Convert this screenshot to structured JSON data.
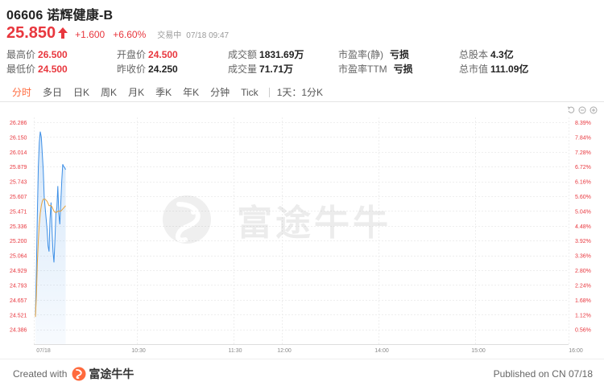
{
  "stock": {
    "title": "06606 诺辉健康-B",
    "price": "25.850",
    "change": "+1.600",
    "change_pct": "+6.60%",
    "status_label": "交易中",
    "datetime": "07/18 09:47"
  },
  "stats": {
    "high_label": "最高价",
    "high": "26.500",
    "low_label": "最低价",
    "low": "24.500",
    "open_label": "开盘价",
    "open": "24.500",
    "prev_close_label": "昨收价",
    "prev_close": "24.250",
    "turnover_label": "成交额",
    "turnover": "1831.69万",
    "volume_label": "成交量",
    "volume": "71.71万",
    "pe_static_label": "市盈率(静)",
    "pe_static": "亏损",
    "pe_ttm_label": "市盈率TTM",
    "pe_ttm": "亏损",
    "shares_label": "总股本",
    "shares": "4.3亿",
    "mktcap_label": "总市值",
    "mktcap": "111.09亿"
  },
  "tabs": {
    "items": [
      "分时",
      "多日",
      "日K",
      "周K",
      "月K",
      "季K",
      "年K",
      "分钟",
      "Tick"
    ],
    "active_index": 0,
    "period": "1天：1分K"
  },
  "watermark": {
    "text": "富途牛牛"
  },
  "footer": {
    "created_with": "Created with",
    "brand": "富途牛牛",
    "published": "Published on CN 07/18"
  },
  "colors": {
    "up": "#e8373e",
    "down": "#2aa14b",
    "price_line": "#3d8fe6",
    "avg_line": "#e8a23a",
    "tab_active": "#ff6a3d"
  },
  "chart_data": {
    "type": "line",
    "y_ticks": [
      "26.286",
      "26.150",
      "26.014",
      "25.879",
      "25.743",
      "25.607",
      "25.471",
      "25.336",
      "25.200",
      "25.064",
      "24.929",
      "24.793",
      "24.657",
      "24.521",
      "24.386"
    ],
    "pct_ticks": [
      "8.39%",
      "7.84%",
      "7.28%",
      "6.72%",
      "6.16%",
      "5.60%",
      "5.04%",
      "4.48%",
      "3.92%",
      "3.36%",
      "2.80%",
      "2.24%",
      "1.68%",
      "1.12%",
      "0.56%"
    ],
    "ylim": [
      24.25,
      26.286
    ],
    "x_ticks": [
      "07/18",
      "10:30",
      "11:30",
      "12:00",
      "14:00",
      "15:00",
      "16:00"
    ],
    "series": [
      {
        "values": [
          24.5,
          24.93,
          25.45,
          25.88,
          26.1,
          26.2,
          26.15,
          26.0,
          25.85,
          25.6,
          25.5,
          25.4,
          25.3,
          25.15,
          25.1,
          25.4,
          25.55,
          25.3,
          25.1,
          25.0,
          25.2,
          25.45,
          25.5,
          25.7,
          25.45,
          25.35,
          25.55,
          25.75,
          25.9,
          25.88,
          25.87,
          25.85
        ]
      },
      {
        "values": [
          24.5,
          24.7,
          25.0,
          25.2,
          25.35,
          25.45,
          25.52,
          25.56,
          25.58,
          25.58,
          25.58,
          25.57,
          25.56,
          25.54,
          25.52,
          25.52,
          25.52,
          25.51,
          25.49,
          25.47,
          25.46,
          25.46,
          25.46,
          25.47,
          25.47,
          25.47,
          25.47,
          25.48,
          25.49,
          25.5,
          25.51,
          25.52
        ]
      }
    ]
  }
}
